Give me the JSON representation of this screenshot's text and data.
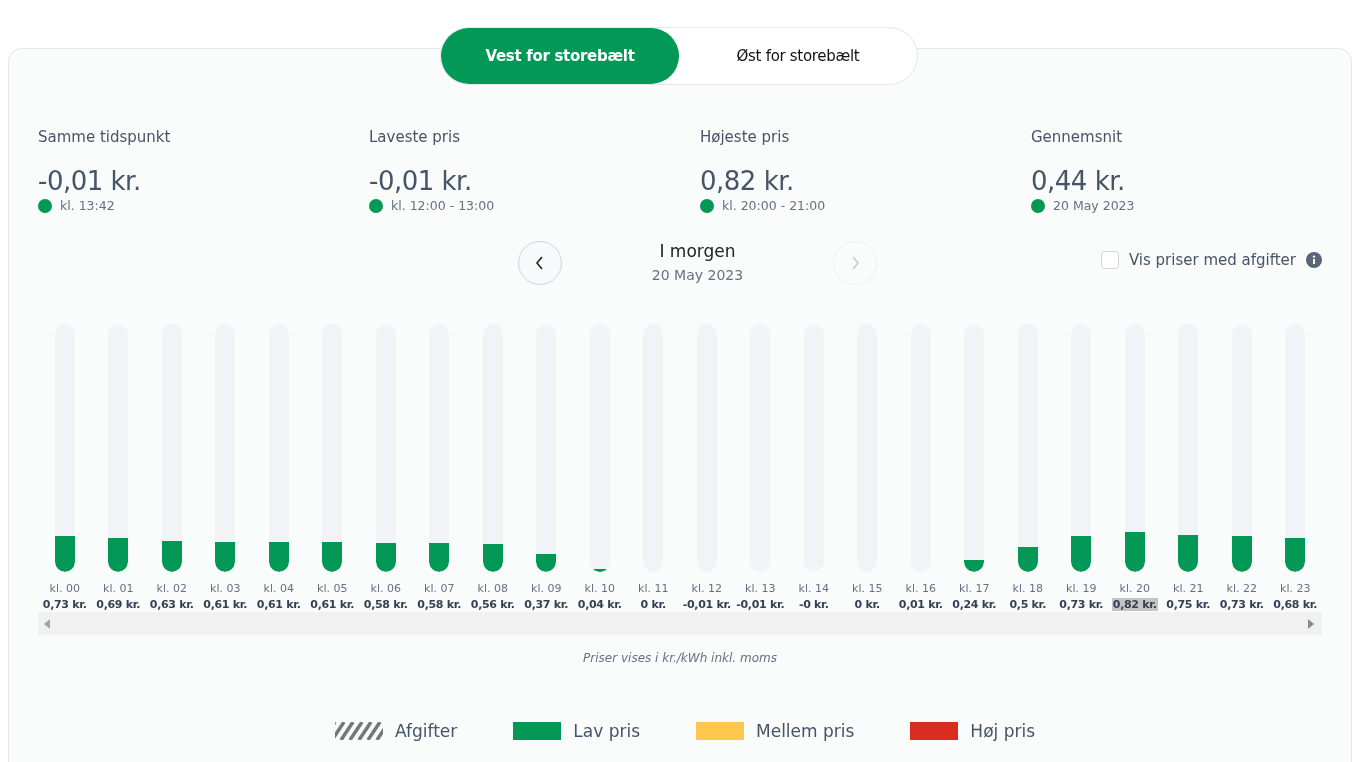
{
  "region_tabs": [
    {
      "label": "Vest for storebælt",
      "selected": true
    },
    {
      "label": "Øst for storebælt",
      "selected": false
    }
  ],
  "stats": [
    {
      "title": "Samme tidspunkt",
      "value": "-0,01 kr.",
      "note": "kl. 13:42",
      "color": "#039855"
    },
    {
      "title": "Laveste pris",
      "value": "-0,01 kr.",
      "note": "kl. 12:00 - 13:00",
      "color": "#039855"
    },
    {
      "title": "Højeste pris",
      "value": "0,82 kr.",
      "note": "kl. 20:00 - 21:00",
      "color": "#039855"
    },
    {
      "title": "Gennemsnit",
      "value": "0,44 kr.",
      "note": "20 May 2023",
      "color": "#039855"
    }
  ],
  "day_nav": {
    "title": "I morgen",
    "date": "20 May 2023",
    "prev_disabled": false,
    "next_disabled": true
  },
  "tax_toggle": {
    "label": "Vis priser med afgifter",
    "checked": false
  },
  "hours": [
    {
      "hour": "kl. 00",
      "price": "0,73 kr.",
      "level": 0.145,
      "highlighted": false
    },
    {
      "hour": "kl. 01",
      "price": "0,69 kr.",
      "level": 0.137,
      "highlighted": false
    },
    {
      "hour": "kl. 02",
      "price": "0,63 kr.",
      "level": 0.125,
      "highlighted": false
    },
    {
      "hour": "kl. 03",
      "price": "0,61 kr.",
      "level": 0.121,
      "highlighted": false
    },
    {
      "hour": "kl. 04",
      "price": "0,61 kr.",
      "level": 0.121,
      "highlighted": false
    },
    {
      "hour": "kl. 05",
      "price": "0,61 kr.",
      "level": 0.121,
      "highlighted": false
    },
    {
      "hour": "kl. 06",
      "price": "0,58 kr.",
      "level": 0.117,
      "highlighted": false
    },
    {
      "hour": "kl. 07",
      "price": "0,58 kr.",
      "level": 0.117,
      "highlighted": false
    },
    {
      "hour": "kl. 08",
      "price": "0,56 kr.",
      "level": 0.113,
      "highlighted": false
    },
    {
      "hour": "kl. 09",
      "price": "0,37 kr.",
      "level": 0.073,
      "highlighted": false
    },
    {
      "hour": "kl. 10",
      "price": "0,04 kr.",
      "level": 0.012,
      "highlighted": false
    },
    {
      "hour": "kl. 11",
      "price": "0 kr.",
      "highlighted": false
    },
    {
      "hour": "kl. 12",
      "price": "-0,01 kr.",
      "highlighted": false
    },
    {
      "hour": "kl. 13",
      "price": "-0,01 kr.",
      "highlighted": false
    },
    {
      "hour": "kl. 14",
      "price": "-0 kr.",
      "highlighted": false
    },
    {
      "hour": "kl. 15",
      "price": "0 kr.",
      "highlighted": false
    },
    {
      "hour": "kl. 16",
      "price": "0,01 kr.",
      "highlighted": false
    },
    {
      "hour": "kl. 17",
      "price": "0,24 kr.",
      "level": 0.048,
      "highlighted": false
    },
    {
      "hour": "kl. 18",
      "price": "0,5 kr.",
      "level": 0.101,
      "highlighted": false
    },
    {
      "hour": "kl. 19",
      "price": "0,73 kr.",
      "level": 0.145,
      "highlighted": false
    },
    {
      "hour": "kl. 20",
      "price": "0,82 kr.",
      "level": 0.161,
      "highlighted": true
    },
    {
      "hour": "kl. 21",
      "price": "0,75 kr.",
      "level": 0.149,
      "highlighted": false
    },
    {
      "hour": "kl. 22",
      "price": "0,73 kr.",
      "level": 0.145,
      "highlighted": false
    },
    {
      "hour": "kl. 23",
      "price": "0,68 kr.",
      "level": 0.137,
      "highlighted": false
    }
  ],
  "footnote": "Priser vises i kr./kWh inkl. moms",
  "legend": [
    {
      "kind": "hatched",
      "label": "Afgifter",
      "color": "#777777"
    },
    {
      "kind": "solid",
      "label": "Lav pris",
      "color": "#039855"
    },
    {
      "kind": "solid",
      "label": "Mellem pris",
      "color": "#fdc64c"
    },
    {
      "kind": "solid",
      "label": "Høj pris",
      "color": "#d92d20"
    }
  ]
}
